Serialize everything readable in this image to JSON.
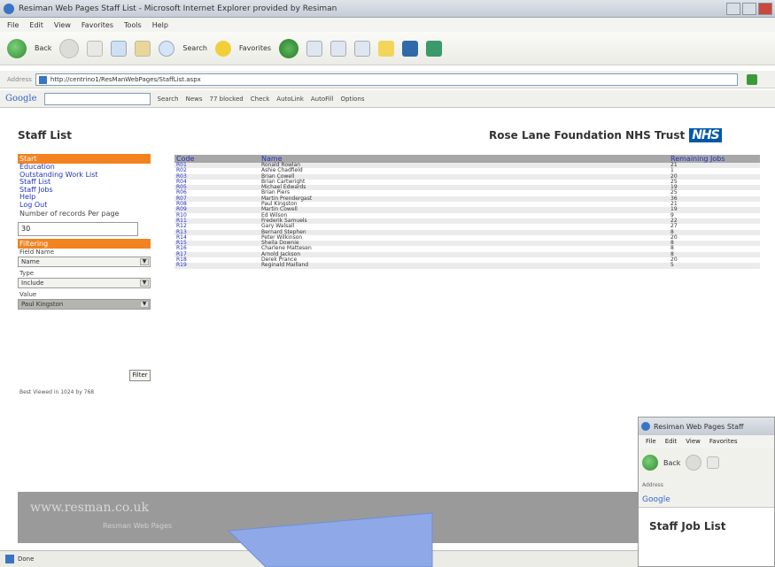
{
  "window": {
    "title": "Resiman Web Pages Staff List - Microsoft Internet Explorer provided by Resiman"
  },
  "menu": [
    "File",
    "Edit",
    "View",
    "Favorites",
    "Tools",
    "Help"
  ],
  "toolbar": {
    "back": "Back",
    "search": "Search",
    "favorites": "Favorites"
  },
  "address": {
    "label": "Address",
    "url": "http://centrino1/ResManWebPages/StaffList.aspx"
  },
  "googlebar": {
    "logo": "Google",
    "buttons": [
      "Search",
      "News",
      "77 blocked",
      "Check",
      "AutoLink",
      "AutoFill",
      "Options"
    ]
  },
  "page": {
    "title": "Staff List",
    "org": "Rose Lane Foundation NHS Trust",
    "nhs": "NHS"
  },
  "sidebar": {
    "nav_header": "Start",
    "links": [
      "Education",
      "Outstanding Work List",
      "Staff List",
      "Staff Jobs",
      "Help",
      "Log Out"
    ],
    "records_label": "Number of records Per page",
    "records_value": "30",
    "filter_header": "Filtering",
    "field_label": "Field Name",
    "field_value": "Name",
    "type_label": "Type",
    "type_value": "Include",
    "value_label": "Value",
    "value_value": "Paul Kingston",
    "filter_button": "Filter",
    "best_viewed": "Best Viewed in 1024 by 768"
  },
  "table": {
    "headers": [
      "Code",
      "Name",
      "Remaining Jobs"
    ],
    "rows": [
      [
        "R01",
        "Ronald Rowlan",
        "21"
      ],
      [
        "R02",
        "Ashie Chadfield",
        "1"
      ],
      [
        "R03",
        "Brian Cowell",
        "20"
      ],
      [
        "R04",
        "Brian Cartwright",
        "25"
      ],
      [
        "R05",
        "Michael Edwards",
        "19"
      ],
      [
        "R06",
        "Brian Piers",
        "25"
      ],
      [
        "R07",
        "Martin Prendergast",
        "36"
      ],
      [
        "R08",
        "Paul Kingston",
        "21"
      ],
      [
        "R09",
        "Martin Cowell",
        "19"
      ],
      [
        "R10",
        "Ed Wilson",
        "9"
      ],
      [
        "R11",
        "Frederik Samuels",
        "22"
      ],
      [
        "R12",
        "Gary Walsall",
        "27"
      ],
      [
        "R13",
        "Bernard Stephen",
        "8"
      ],
      [
        "R14",
        "Peter Wilkinson",
        "20"
      ],
      [
        "R15",
        "Sheila Downie",
        "8"
      ],
      [
        "R16",
        "Charlene Mattesen",
        "8"
      ],
      [
        "R17",
        "Arnold Jackson",
        "8"
      ],
      [
        "R18",
        "Derek Prance",
        "20"
      ],
      [
        "R19",
        "Reginald Mailland",
        "5"
      ]
    ]
  },
  "footer": {
    "url": "www.resman.co.uk",
    "sub": "Resman Web Pages"
  },
  "statusbar": {
    "text": "Done"
  },
  "inset": {
    "title": "Resiman Web Pages Staff",
    "menu": [
      "File",
      "Edit",
      "View",
      "Favorites"
    ],
    "back": "Back",
    "google": "Google",
    "page_title": "Staff Job List"
  },
  "colors": {
    "accent": "#f28320",
    "link": "#2233bb",
    "nhs": "#0058a8",
    "arrow": "#8ea8e8"
  }
}
